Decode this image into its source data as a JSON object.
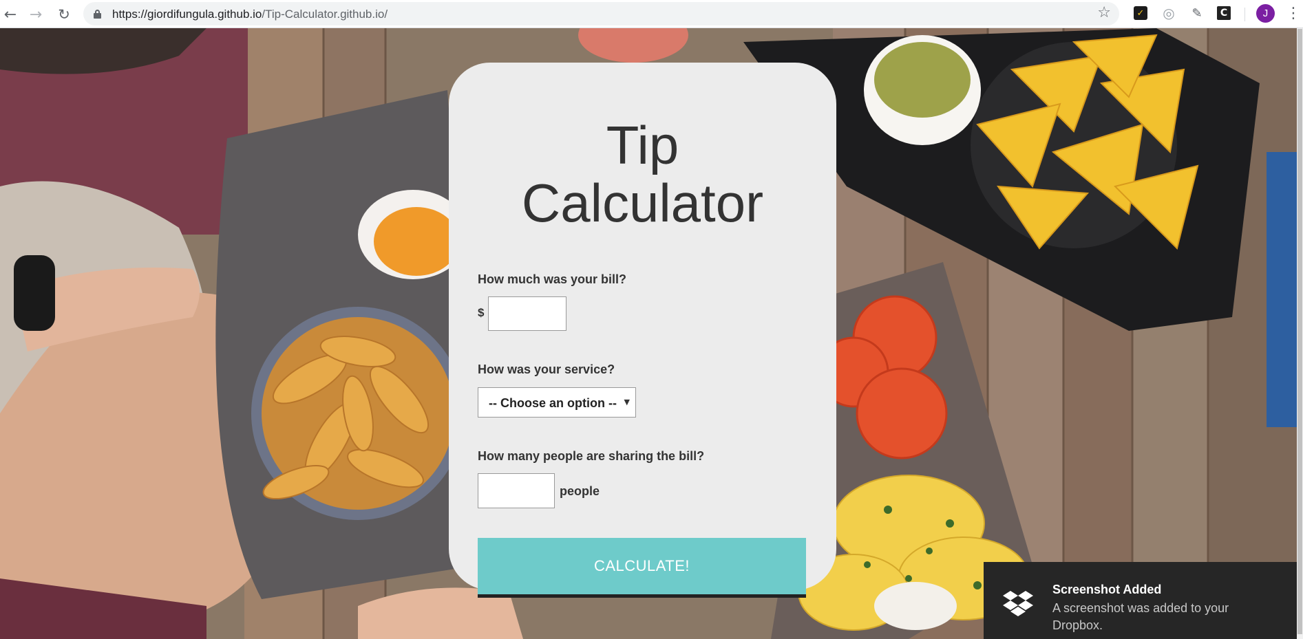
{
  "browser": {
    "url_host": "https://giordifungula.github.io",
    "url_path": "/Tip-Calculator.github.io/",
    "avatar_letter": "J",
    "icons": {
      "back": "arrow-left-icon",
      "forward": "arrow-right-icon",
      "reload": "reload-icon",
      "lock": "lock-icon",
      "bookmark": "star-icon",
      "menu": "more-vertical-icon"
    }
  },
  "calculator": {
    "title_line1": "Tip",
    "title_line2": "Calculator",
    "bill_question": "How much was your bill?",
    "currency_symbol": "$",
    "bill_value": "",
    "service_question": "How was your service?",
    "service_selected": "-- Choose an option --",
    "people_question": "How many people are sharing the bill?",
    "people_value": "",
    "people_unit": "people",
    "calculate_label": "CALCULATE!",
    "accent_color": "#6ecbca"
  },
  "toast": {
    "title": "Screenshot Added",
    "message": "A screenshot was added to your Dropbox.",
    "icon": "dropbox-icon"
  }
}
